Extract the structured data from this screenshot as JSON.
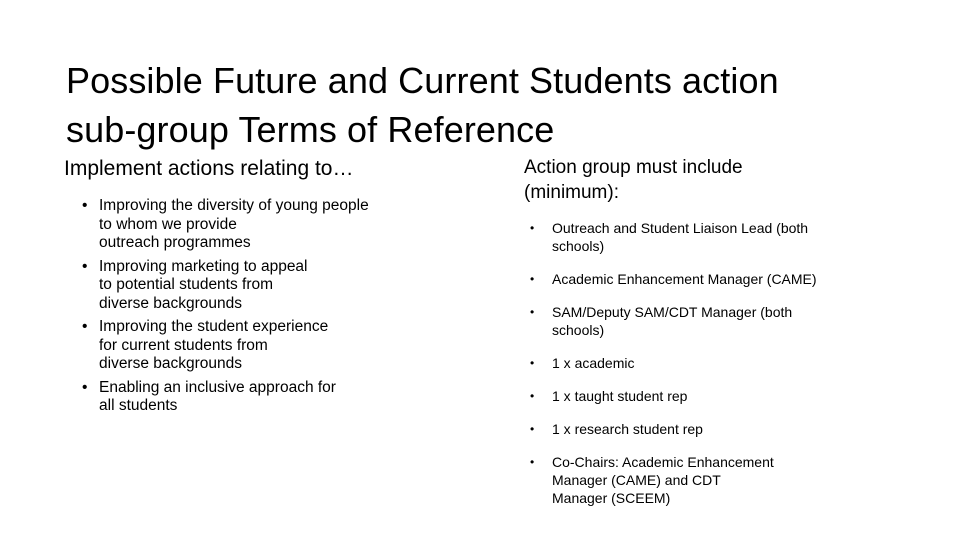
{
  "slide": {
    "title": "Possible Future and Current Students action\nsub-group Terms of Reference",
    "background_color": "#ffffff",
    "text_color": "#000000",
    "left_column": {
      "heading": "Implement actions relating to…",
      "bullets": [
        "Improving the diversity of young people\nto whom we provide\noutreach programmes",
        "Improving marketing to appeal\nto potential students from\ndiverse backgrounds",
        "Improving the student experience\nfor current students from\ndiverse backgrounds",
        "Enabling an inclusive approach for\nall students"
      ]
    },
    "right_column": {
      "heading": "Action group must include\n(minimum):",
      "bullets": [
        "Outreach and Student Liaison Lead (both\nschools)",
        "Academic Enhancement Manager (CAME)",
        "SAM/Deputy SAM/CDT Manager (both\nschools)",
        "1 x academic",
        "1 x taught student rep",
        "1 x research student rep",
        "Co-Chairs: Academic Enhancement\nManager (CAME) and CDT\nManager (SCEEM)"
      ]
    }
  }
}
